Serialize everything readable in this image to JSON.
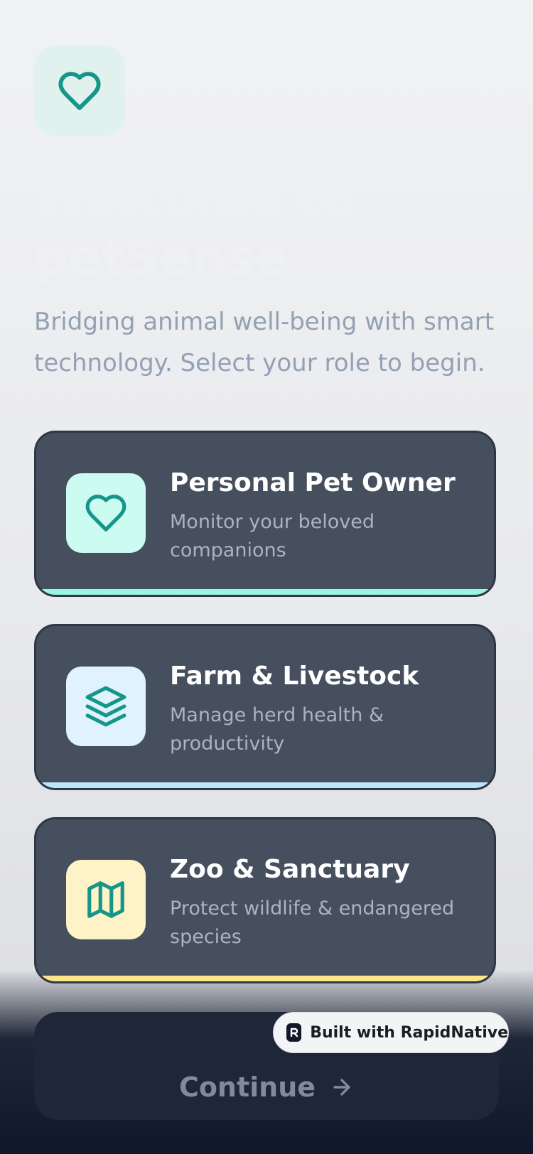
{
  "header": {
    "app_icon": "heart-icon",
    "title": "Welcome to petSense",
    "subtitle": "Bridging animal well-being with smart technology. Select your role to begin."
  },
  "roles": [
    {
      "title": "Personal Pet Owner",
      "description": "Monitor your beloved companions",
      "icon": "heart-icon",
      "icon_bg": "#ccfbf1",
      "accent": "#99f6e4"
    },
    {
      "title": "Farm & Livestock",
      "description": "Manage herd health & productivity",
      "icon": "layers-icon",
      "icon_bg": "#e0f2fe",
      "accent": "#bae6fd"
    },
    {
      "title": "Zoo & Sanctuary",
      "description": "Protect wildlife & endangered species",
      "icon": "map-icon",
      "icon_bg": "#fef3c7",
      "accent": "#fde68a"
    }
  ],
  "footer": {
    "continue_label": "Continue",
    "continue_icon": "arrow-right-icon",
    "badge_label": "Built with RapidNative"
  },
  "colors": {
    "teal_icon": "#149688",
    "card_bg": "#454f5e",
    "button_bg": "#1e2637"
  }
}
